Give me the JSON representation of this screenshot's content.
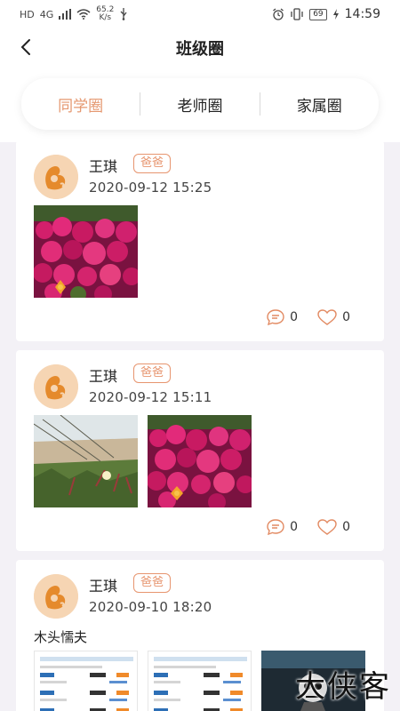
{
  "status_bar": {
    "left_icons": [
      "HD",
      "4G"
    ],
    "speed_value": "65.2",
    "speed_unit": "K/s",
    "battery": "69",
    "time": "14:59"
  },
  "header": {
    "title": "班级圈"
  },
  "tabs": [
    {
      "label": "同学圈",
      "active": true
    },
    {
      "label": "老师圈",
      "active": false
    },
    {
      "label": "家属圈",
      "active": false
    }
  ],
  "posts": [
    {
      "user": "王琪",
      "role": "爸爸",
      "time": "2020-09-12 15:25",
      "text": "",
      "photos": [
        "magenta-flowers"
      ],
      "comments": "0",
      "likes": "0"
    },
    {
      "user": "王琪",
      "role": "爸爸",
      "time": "2020-09-12 15:11",
      "text": "",
      "photos": [
        "dune-plants",
        "magenta-flowers"
      ],
      "comments": "0",
      "likes": "0"
    },
    {
      "user": "王琪",
      "role": "爸爸",
      "time": "2020-09-10 18:20",
      "text": "木头懦夫",
      "photos": [
        "ticket-screenshot",
        "ticket-screenshot",
        "dark-illustration"
      ]
    }
  ],
  "watermark": "大侠客",
  "colors": {
    "accent": "#e59870",
    "background": "#f3f1f6",
    "card": "#ffffff"
  }
}
